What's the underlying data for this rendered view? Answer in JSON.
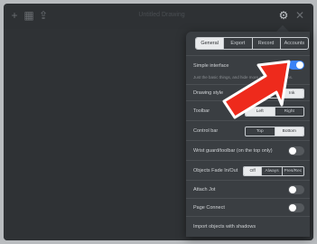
{
  "window": {
    "title": "Untitled Drawing"
  },
  "toolbar": {
    "left_icons": [
      "plus-icon",
      "grid-icon",
      "share-icon"
    ],
    "right_icons": [
      "gear-icon",
      "close-icon"
    ]
  },
  "settings": {
    "tabs": [
      {
        "label": "General",
        "active": true
      },
      {
        "label": "Export",
        "active": false
      },
      {
        "label": "Record",
        "active": false
      },
      {
        "label": "Accounts",
        "active": false
      }
    ],
    "simple_interface": {
      "label": "Simple interface",
      "on": true,
      "sub": "Just the basic things, and hide more advanced buttons."
    },
    "drawing_style": {
      "label": "Drawing style",
      "options": [
        "",
        "Ink"
      ],
      "selected": 1
    },
    "toolbar_side": {
      "label": "Toolbar",
      "options": [
        "Left",
        "Right"
      ],
      "selected": 0
    },
    "control_bar": {
      "label": "Control bar",
      "options": [
        "Top",
        "Bottom"
      ],
      "selected": 1
    },
    "wrist_guard": {
      "label": "Wrist guard/toolbar (on the top only)",
      "on": false
    },
    "objects_fade": {
      "label": "Objects Fade In/Out",
      "options": [
        "Off",
        "Always",
        "Pres/Rec"
      ],
      "selected": 0
    },
    "attach_jot": {
      "label": "Attach Jot",
      "on": false
    },
    "page_connect": {
      "label": "Page Connect",
      "on": false
    },
    "import_shadows": {
      "label": "Import objects with shadows"
    }
  },
  "colors": {
    "accent": "#3b82f6",
    "arrow": "#ee2a1c",
    "background": "#2e3134"
  }
}
